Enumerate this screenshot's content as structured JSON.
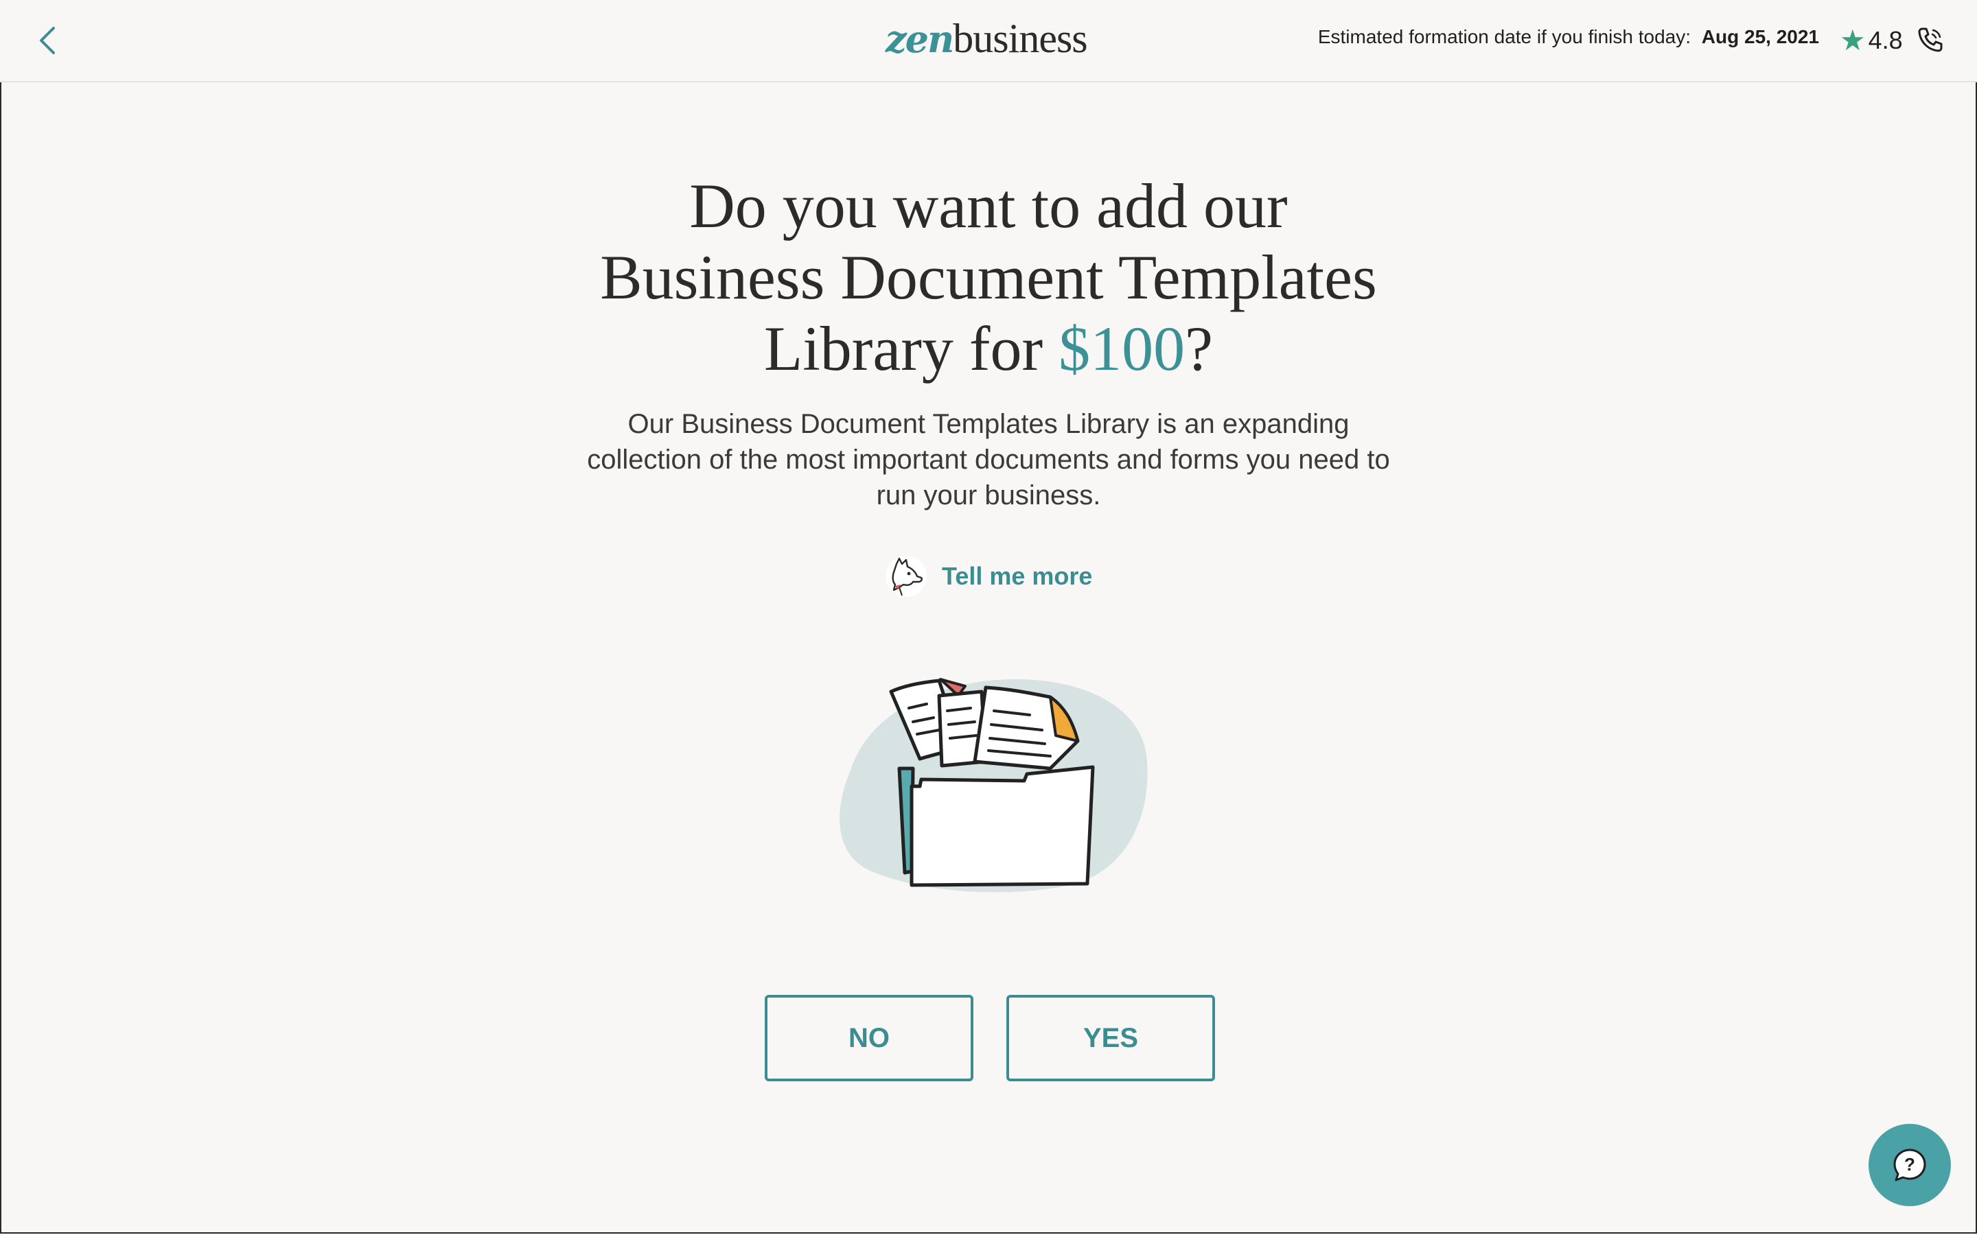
{
  "header": {
    "back_icon": "chevron-left-icon",
    "logo_left": "zen",
    "logo_right": "business",
    "formation_label": "Estimated formation date if you finish today:",
    "formation_date": "Aug 25, 2021",
    "rating": "4.8",
    "star_icon": "star-icon",
    "phone_icon": "phone-icon"
  },
  "main": {
    "title_line1": "Do you want to add our",
    "title_line2": "Business Document Templates",
    "title_line3_prefix": "Library for ",
    "title_price": "$100",
    "title_suffix": "?",
    "description": "Our Business Document Templates Library is an expanding collection of the most important documents and forms you need to run your business.",
    "tell_more_label": "Tell me more",
    "no_label": "NO",
    "yes_label": "YES"
  },
  "chat": {
    "icon": "help-chat-icon"
  },
  "colors": {
    "accent": "#3b8d92",
    "background": "#f8f7f5",
    "star": "#3aa17e",
    "chat_bubble": "#4aa1a6"
  }
}
